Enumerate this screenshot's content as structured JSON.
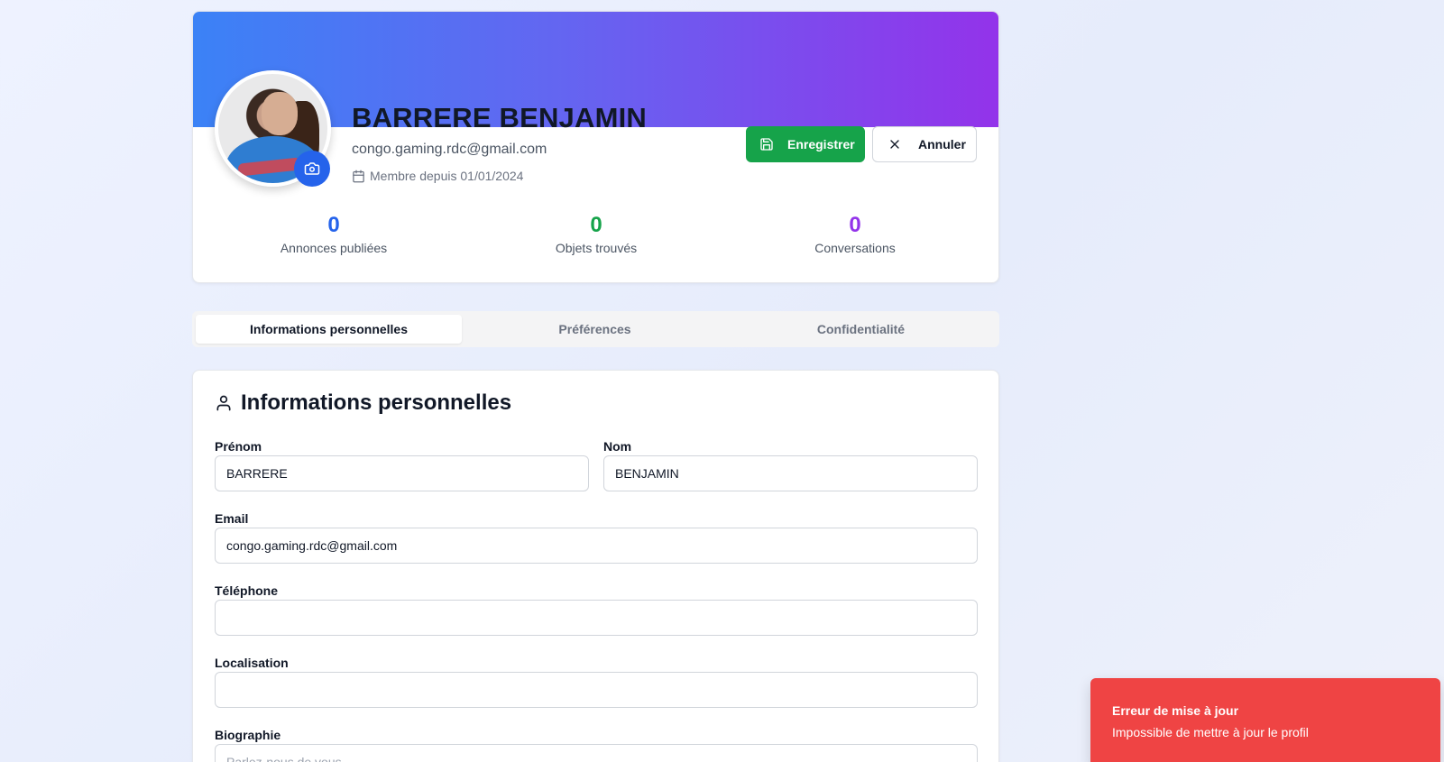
{
  "profile": {
    "full_name": "BARRERE BENJAMIN",
    "email": "congo.gaming.rdc@gmail.com",
    "member_since": "Membre depuis 01/01/2024",
    "save_label": "Enregistrer",
    "cancel_label": "Annuler",
    "stats": [
      {
        "value": "0",
        "label": "Annonces publiées",
        "color": "#2563eb"
      },
      {
        "value": "0",
        "label": "Objets trouvés",
        "color": "#16a34a"
      },
      {
        "value": "0",
        "label": "Conversations",
        "color": "#9333ea"
      }
    ]
  },
  "tabs": [
    {
      "label": "Informations personnelles",
      "active": true
    },
    {
      "label": "Préférences",
      "active": false
    },
    {
      "label": "Confidentialité",
      "active": false
    }
  ],
  "form": {
    "title": "Informations personnelles",
    "fields": {
      "first_name": {
        "label": "Prénom",
        "value": "BARRERE"
      },
      "last_name": {
        "label": "Nom",
        "value": "BENJAMIN"
      },
      "email": {
        "label": "Email",
        "value": "congo.gaming.rdc@gmail.com"
      },
      "phone": {
        "label": "Téléphone",
        "value": ""
      },
      "location": {
        "label": "Localisation",
        "value": ""
      },
      "bio": {
        "label": "Biographie",
        "placeholder": "Parlez-nous de vous..."
      }
    }
  },
  "toast": {
    "title": "Erreur de mise à jour",
    "description": "Impossible de mettre à jour le profil",
    "color": "#ef4444"
  },
  "colors": {
    "banner_start": "#3b82f6",
    "banner_end": "#9333ea",
    "save_button": "#16a34a",
    "camera_button": "#2563eb"
  }
}
